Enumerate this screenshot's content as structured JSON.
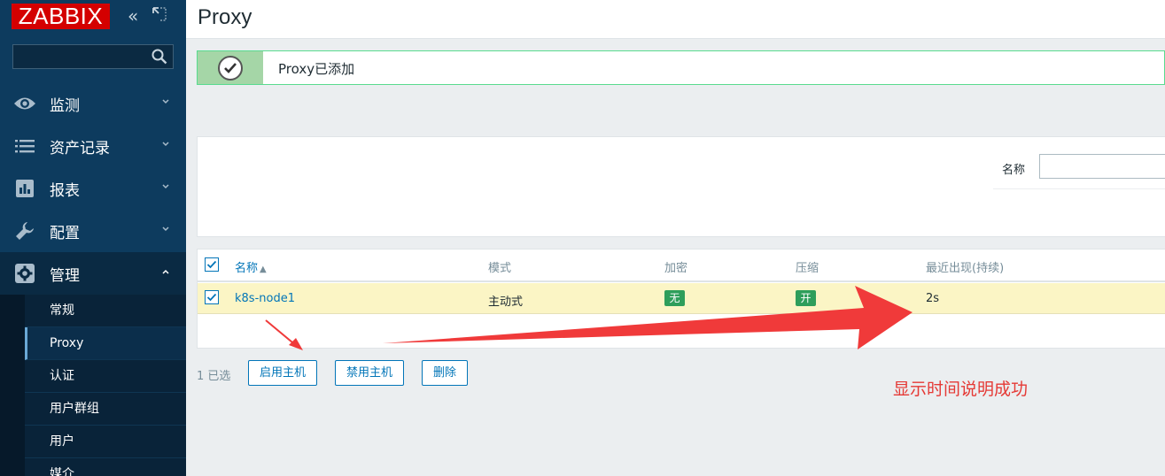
{
  "app": {
    "logo": "ZABBIX"
  },
  "header": {
    "title": "Proxy"
  },
  "sidebar": {
    "menu": [
      {
        "label": "监测",
        "icon": "eye-icon"
      },
      {
        "label": "资产记录",
        "icon": "list-icon"
      },
      {
        "label": "报表",
        "icon": "bar-chart-icon"
      },
      {
        "label": "配置",
        "icon": "wrench-icon"
      },
      {
        "label": "管理",
        "icon": "gear-icon"
      }
    ],
    "submenu": [
      "常规",
      "Proxy",
      "认证",
      "用户群组",
      "用户",
      "媒介"
    ]
  },
  "message": {
    "text": "Proxy已添加"
  },
  "filter": {
    "name_label": "名称",
    "name_value": ""
  },
  "table": {
    "columns": [
      "名称",
      "模式",
      "加密",
      "压缩",
      "最近出现(持续)"
    ],
    "sort_indicator": "▲",
    "rows": [
      {
        "name": "k8s-node1",
        "mode": "主动式",
        "encryption": "无",
        "compression": "开",
        "last_seen": "2s"
      }
    ]
  },
  "actions": {
    "selected_count": "1 已选",
    "enable": "启用主机",
    "disable": "禁用主机",
    "delete": "删除"
  },
  "annotation": {
    "text": "显示时间说明成功",
    "color": "#e53935"
  },
  "colors": {
    "sidebar": "#0d3b5e",
    "accent": "#0275b8",
    "success": "#59db8f",
    "row_highlight": "#fbf5c5",
    "logo": "#d40000"
  }
}
